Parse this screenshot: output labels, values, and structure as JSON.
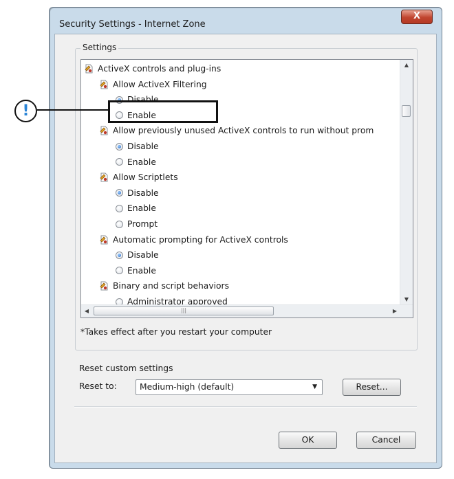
{
  "window": {
    "title": "Security Settings - Internet Zone",
    "close_label": "X"
  },
  "settings": {
    "group_title": "Settings",
    "rows": [
      {
        "kind": "category",
        "level": 0,
        "label": "ActiveX controls and plug-ins"
      },
      {
        "kind": "setting",
        "level": 1,
        "label": "Allow ActiveX Filtering"
      },
      {
        "kind": "option",
        "level": 2,
        "label": "Disable",
        "checked": true
      },
      {
        "kind": "option",
        "level": 2,
        "label": "Enable",
        "checked": false
      },
      {
        "kind": "setting",
        "level": 1,
        "label": "Allow previously unused ActiveX controls to run without prom"
      },
      {
        "kind": "option",
        "level": 2,
        "label": "Disable",
        "checked": true
      },
      {
        "kind": "option",
        "level": 2,
        "label": "Enable",
        "checked": false
      },
      {
        "kind": "setting",
        "level": 1,
        "label": "Allow Scriptlets"
      },
      {
        "kind": "option",
        "level": 2,
        "label": "Disable",
        "checked": true
      },
      {
        "kind": "option",
        "level": 2,
        "label": "Enable",
        "checked": false
      },
      {
        "kind": "option",
        "level": 2,
        "label": "Prompt",
        "checked": false
      },
      {
        "kind": "setting",
        "level": 1,
        "label": "Automatic prompting for ActiveX controls"
      },
      {
        "kind": "option",
        "level": 2,
        "label": "Disable",
        "checked": true
      },
      {
        "kind": "option",
        "level": 2,
        "label": "Enable",
        "checked": false
      },
      {
        "kind": "setting",
        "level": 1,
        "label": "Binary and script behaviors"
      },
      {
        "kind": "option",
        "level": 2,
        "label": "Administrator approved",
        "checked": false
      }
    ],
    "footnote": "*Takes effect after you restart your computer"
  },
  "reset": {
    "section_title": "Reset custom settings",
    "label": "Reset to:",
    "selected": "Medium-high (default)",
    "reset_button": "Reset..."
  },
  "buttons": {
    "ok": "OK",
    "cancel": "Cancel"
  },
  "callout": {
    "symbol": "!",
    "color": "#2a84d6"
  },
  "colors": {
    "frame": "#c9dbea",
    "close_button": "#c0452f",
    "radio_checked": "#1f5fbf"
  }
}
